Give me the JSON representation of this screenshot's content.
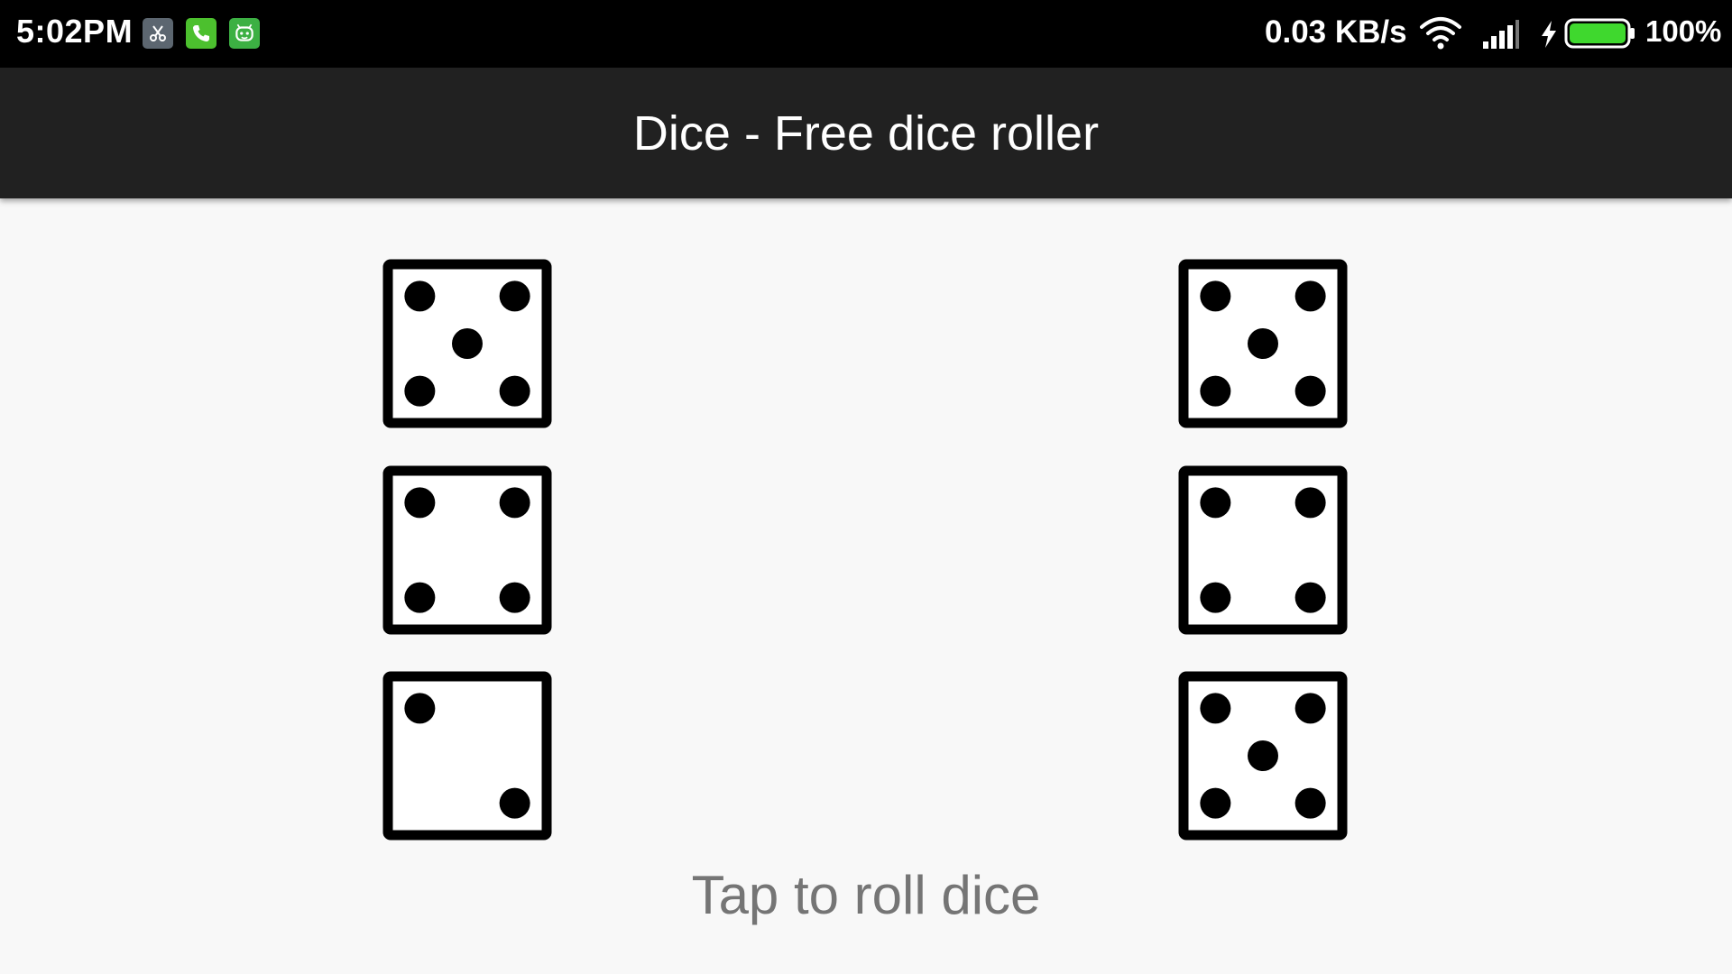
{
  "status_bar": {
    "time": "5:02PM",
    "notification_icons": [
      "scissors-app-icon",
      "phone-icon",
      "android-app-icon"
    ],
    "net_speed": "0.03 KB/s",
    "battery_percent": "100%",
    "battery_level": 1.0,
    "colors": {
      "phone_icon_bg": "#4cc02e",
      "android_icon_bg": "#3cb043",
      "scissors_icon_bg": "#5c6670",
      "battery_fill": "#3fd82e"
    }
  },
  "app_bar": {
    "title": "Dice - Free dice roller",
    "background": "#212121"
  },
  "dice": [
    {
      "name": "die-1",
      "value": 5
    },
    {
      "name": "die-2",
      "value": 5
    },
    {
      "name": "die-3",
      "value": 4
    },
    {
      "name": "die-4",
      "value": 4
    },
    {
      "name": "die-5",
      "value": 2
    },
    {
      "name": "die-6",
      "value": 5
    }
  ],
  "footer": {
    "hint": "Tap to roll dice"
  }
}
